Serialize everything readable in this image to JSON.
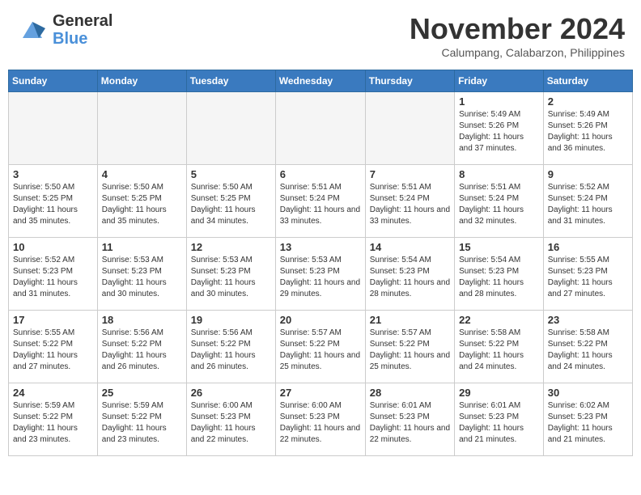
{
  "logo": {
    "line1": "General",
    "line2": "Blue"
  },
  "title": "November 2024",
  "location": "Calumpang, Calabarzon, Philippines",
  "weekdays": [
    "Sunday",
    "Monday",
    "Tuesday",
    "Wednesday",
    "Thursday",
    "Friday",
    "Saturday"
  ],
  "weeks": [
    [
      {
        "day": "",
        "empty": true
      },
      {
        "day": "",
        "empty": true
      },
      {
        "day": "",
        "empty": true
      },
      {
        "day": "",
        "empty": true
      },
      {
        "day": "",
        "empty": true
      },
      {
        "day": "1",
        "sunrise": "5:49 AM",
        "sunset": "5:26 PM",
        "daylight": "11 hours and 37 minutes."
      },
      {
        "day": "2",
        "sunrise": "5:49 AM",
        "sunset": "5:26 PM",
        "daylight": "11 hours and 36 minutes."
      }
    ],
    [
      {
        "day": "3",
        "sunrise": "5:50 AM",
        "sunset": "5:25 PM",
        "daylight": "11 hours and 35 minutes."
      },
      {
        "day": "4",
        "sunrise": "5:50 AM",
        "sunset": "5:25 PM",
        "daylight": "11 hours and 35 minutes."
      },
      {
        "day": "5",
        "sunrise": "5:50 AM",
        "sunset": "5:25 PM",
        "daylight": "11 hours and 34 minutes."
      },
      {
        "day": "6",
        "sunrise": "5:51 AM",
        "sunset": "5:24 PM",
        "daylight": "11 hours and 33 minutes."
      },
      {
        "day": "7",
        "sunrise": "5:51 AM",
        "sunset": "5:24 PM",
        "daylight": "11 hours and 33 minutes."
      },
      {
        "day": "8",
        "sunrise": "5:51 AM",
        "sunset": "5:24 PM",
        "daylight": "11 hours and 32 minutes."
      },
      {
        "day": "9",
        "sunrise": "5:52 AM",
        "sunset": "5:24 PM",
        "daylight": "11 hours and 31 minutes."
      }
    ],
    [
      {
        "day": "10",
        "sunrise": "5:52 AM",
        "sunset": "5:23 PM",
        "daylight": "11 hours and 31 minutes."
      },
      {
        "day": "11",
        "sunrise": "5:53 AM",
        "sunset": "5:23 PM",
        "daylight": "11 hours and 30 minutes."
      },
      {
        "day": "12",
        "sunrise": "5:53 AM",
        "sunset": "5:23 PM",
        "daylight": "11 hours and 30 minutes."
      },
      {
        "day": "13",
        "sunrise": "5:53 AM",
        "sunset": "5:23 PM",
        "daylight": "11 hours and 29 minutes."
      },
      {
        "day": "14",
        "sunrise": "5:54 AM",
        "sunset": "5:23 PM",
        "daylight": "11 hours and 28 minutes."
      },
      {
        "day": "15",
        "sunrise": "5:54 AM",
        "sunset": "5:23 PM",
        "daylight": "11 hours and 28 minutes."
      },
      {
        "day": "16",
        "sunrise": "5:55 AM",
        "sunset": "5:23 PM",
        "daylight": "11 hours and 27 minutes."
      }
    ],
    [
      {
        "day": "17",
        "sunrise": "5:55 AM",
        "sunset": "5:22 PM",
        "daylight": "11 hours and 27 minutes."
      },
      {
        "day": "18",
        "sunrise": "5:56 AM",
        "sunset": "5:22 PM",
        "daylight": "11 hours and 26 minutes."
      },
      {
        "day": "19",
        "sunrise": "5:56 AM",
        "sunset": "5:22 PM",
        "daylight": "11 hours and 26 minutes."
      },
      {
        "day": "20",
        "sunrise": "5:57 AM",
        "sunset": "5:22 PM",
        "daylight": "11 hours and 25 minutes."
      },
      {
        "day": "21",
        "sunrise": "5:57 AM",
        "sunset": "5:22 PM",
        "daylight": "11 hours and 25 minutes."
      },
      {
        "day": "22",
        "sunrise": "5:58 AM",
        "sunset": "5:22 PM",
        "daylight": "11 hours and 24 minutes."
      },
      {
        "day": "23",
        "sunrise": "5:58 AM",
        "sunset": "5:22 PM",
        "daylight": "11 hours and 24 minutes."
      }
    ],
    [
      {
        "day": "24",
        "sunrise": "5:59 AM",
        "sunset": "5:22 PM",
        "daylight": "11 hours and 23 minutes."
      },
      {
        "day": "25",
        "sunrise": "5:59 AM",
        "sunset": "5:22 PM",
        "daylight": "11 hours and 23 minutes."
      },
      {
        "day": "26",
        "sunrise": "6:00 AM",
        "sunset": "5:23 PM",
        "daylight": "11 hours and 22 minutes."
      },
      {
        "day": "27",
        "sunrise": "6:00 AM",
        "sunset": "5:23 PM",
        "daylight": "11 hours and 22 minutes."
      },
      {
        "day": "28",
        "sunrise": "6:01 AM",
        "sunset": "5:23 PM",
        "daylight": "11 hours and 22 minutes."
      },
      {
        "day": "29",
        "sunrise": "6:01 AM",
        "sunset": "5:23 PM",
        "daylight": "11 hours and 21 minutes."
      },
      {
        "day": "30",
        "sunrise": "6:02 AM",
        "sunset": "5:23 PM",
        "daylight": "11 hours and 21 minutes."
      }
    ]
  ]
}
